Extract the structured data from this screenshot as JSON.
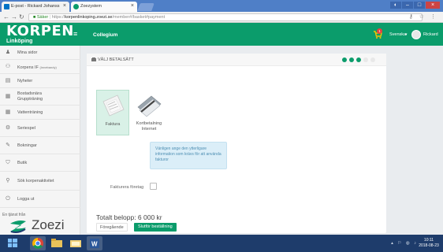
{
  "browser": {
    "tabs": [
      {
        "title": "E-post - Rickard Johanss",
        "active": false
      },
      {
        "title": "Zoezystem",
        "active": true
      }
    ],
    "url_secure_label": "Säker",
    "url_scheme": "https://",
    "url_host": "korpenlinkoping.zoezi.se",
    "url_path": "/member#/basket#payment"
  },
  "header": {
    "logo": "KORPEN",
    "logo_sub": "Linköping",
    "title": "Collegium",
    "cart_count": "1",
    "language": "Svenska",
    "user": "Rickard"
  },
  "sidebar": {
    "items": [
      {
        "icon": "user-icon",
        "label": "Mina sidor",
        "sub": ""
      },
      {
        "icon": "group-icon",
        "label": "Korpens IF ",
        "sub": "(Innebandy)"
      },
      {
        "icon": "news-icon",
        "label": "Nyheter",
        "sub": ""
      },
      {
        "icon": "calendar-icon",
        "label": "Bostadsnära Gruppträning",
        "sub": ""
      },
      {
        "icon": "calendar-icon",
        "label": "Vattenträning",
        "sub": ""
      },
      {
        "icon": "gear-icon",
        "label": "Seriespel",
        "sub": ""
      },
      {
        "icon": "pen-icon",
        "label": "Bokningar",
        "sub": ""
      },
      {
        "icon": "basket-icon",
        "label": "Butik",
        "sub": ""
      },
      {
        "icon": "search-icon",
        "label": "Sök korpenaktivitet",
        "sub": ""
      },
      {
        "icon": "power-icon",
        "label": "Logga ut",
        "sub": ""
      }
    ],
    "brand_pre": "En tjänst från",
    "brand": "Zoezi"
  },
  "payment": {
    "title": "Välj betalsätt",
    "steps_total": 5,
    "steps_done": 3,
    "options": [
      {
        "label": "Faktura",
        "selected": true
      },
      {
        "label": "Kortbetalning Internet",
        "selected": false
      }
    ],
    "info": "Vänligen ange den ytterligare information som krävs för att använda fakturor",
    "company_invoice_label": "Fakturera företag",
    "total": "Totalt belopp: 6 000 kr",
    "prev_button": "Föregående",
    "finish_button": "Slutför beställning"
  },
  "taskbar": {
    "time": "10:11",
    "date": "2018-08-23"
  },
  "colors": {
    "brand_green": "#0b9c6b",
    "info_bg": "#dbeef8",
    "taskbar": "#1e3c6b"
  }
}
